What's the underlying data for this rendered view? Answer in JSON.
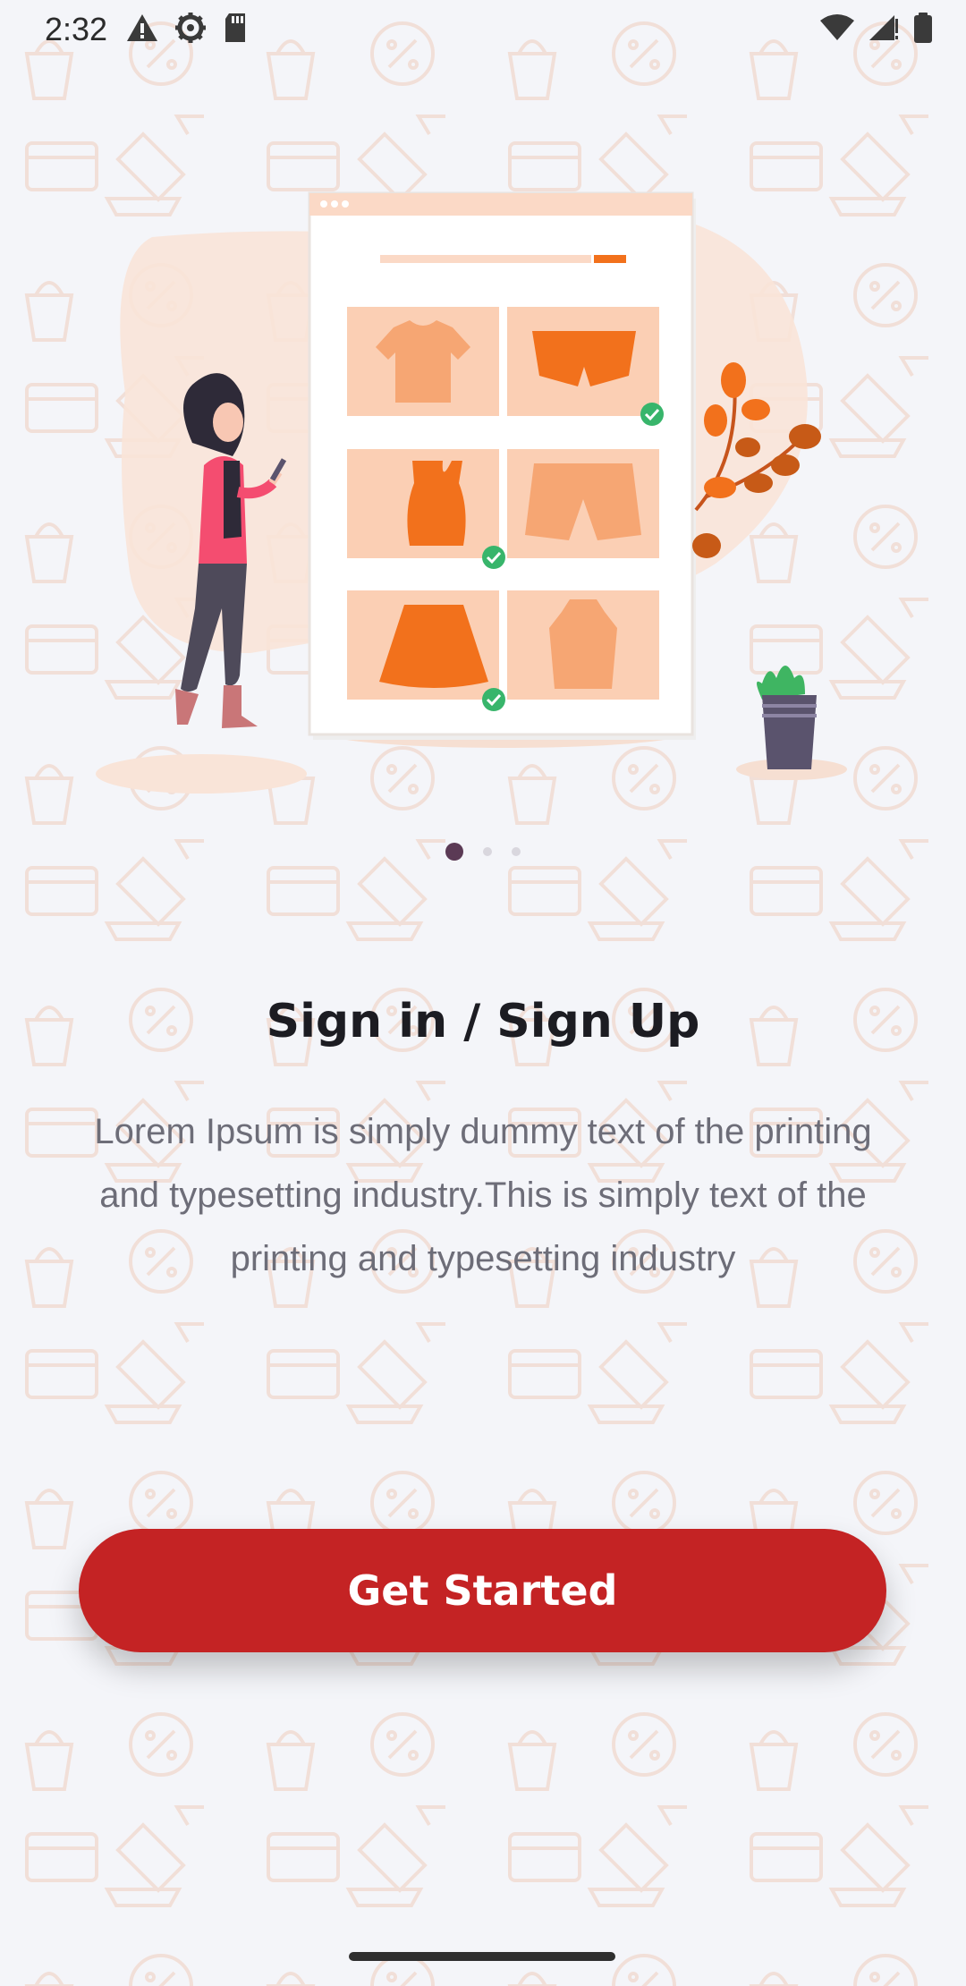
{
  "status_bar": {
    "time": "2:32",
    "left_icons": [
      "warning-icon",
      "settings-icon",
      "sd-card-icon"
    ],
    "right_icons": [
      "wifi-icon",
      "cellular-signal-icon",
      "battery-icon"
    ]
  },
  "onboarding": {
    "page_indicator": {
      "count": 3,
      "active_index": 0
    },
    "title": "Sign in / Sign Up",
    "description": "Lorem Ipsum is simply dummy text of the printing and typesetting industry.This is simply text of the printing and typesetting industry",
    "cta_label": "Get Started"
  },
  "colors": {
    "background": "#f4f5f9",
    "accent": "#c42324",
    "illustration_orange": "#f2711c",
    "active_dot": "#5b3a55"
  }
}
